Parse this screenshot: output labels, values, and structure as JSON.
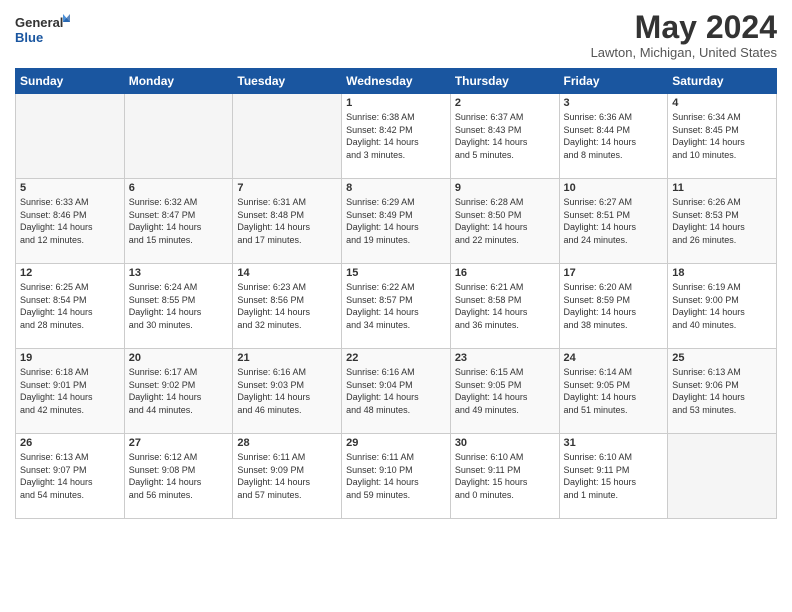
{
  "logo": {
    "line1": "General",
    "line2": "Blue"
  },
  "title": "May 2024",
  "location": "Lawton, Michigan, United States",
  "headers": [
    "Sunday",
    "Monday",
    "Tuesday",
    "Wednesday",
    "Thursday",
    "Friday",
    "Saturday"
  ],
  "weeks": [
    [
      {
        "day": "",
        "info": ""
      },
      {
        "day": "",
        "info": ""
      },
      {
        "day": "",
        "info": ""
      },
      {
        "day": "1",
        "info": "Sunrise: 6:38 AM\nSunset: 8:42 PM\nDaylight: 14 hours\nand 3 minutes."
      },
      {
        "day": "2",
        "info": "Sunrise: 6:37 AM\nSunset: 8:43 PM\nDaylight: 14 hours\nand 5 minutes."
      },
      {
        "day": "3",
        "info": "Sunrise: 6:36 AM\nSunset: 8:44 PM\nDaylight: 14 hours\nand 8 minutes."
      },
      {
        "day": "4",
        "info": "Sunrise: 6:34 AM\nSunset: 8:45 PM\nDaylight: 14 hours\nand 10 minutes."
      }
    ],
    [
      {
        "day": "5",
        "info": "Sunrise: 6:33 AM\nSunset: 8:46 PM\nDaylight: 14 hours\nand 12 minutes."
      },
      {
        "day": "6",
        "info": "Sunrise: 6:32 AM\nSunset: 8:47 PM\nDaylight: 14 hours\nand 15 minutes."
      },
      {
        "day": "7",
        "info": "Sunrise: 6:31 AM\nSunset: 8:48 PM\nDaylight: 14 hours\nand 17 minutes."
      },
      {
        "day": "8",
        "info": "Sunrise: 6:29 AM\nSunset: 8:49 PM\nDaylight: 14 hours\nand 19 minutes."
      },
      {
        "day": "9",
        "info": "Sunrise: 6:28 AM\nSunset: 8:50 PM\nDaylight: 14 hours\nand 22 minutes."
      },
      {
        "day": "10",
        "info": "Sunrise: 6:27 AM\nSunset: 8:51 PM\nDaylight: 14 hours\nand 24 minutes."
      },
      {
        "day": "11",
        "info": "Sunrise: 6:26 AM\nSunset: 8:53 PM\nDaylight: 14 hours\nand 26 minutes."
      }
    ],
    [
      {
        "day": "12",
        "info": "Sunrise: 6:25 AM\nSunset: 8:54 PM\nDaylight: 14 hours\nand 28 minutes."
      },
      {
        "day": "13",
        "info": "Sunrise: 6:24 AM\nSunset: 8:55 PM\nDaylight: 14 hours\nand 30 minutes."
      },
      {
        "day": "14",
        "info": "Sunrise: 6:23 AM\nSunset: 8:56 PM\nDaylight: 14 hours\nand 32 minutes."
      },
      {
        "day": "15",
        "info": "Sunrise: 6:22 AM\nSunset: 8:57 PM\nDaylight: 14 hours\nand 34 minutes."
      },
      {
        "day": "16",
        "info": "Sunrise: 6:21 AM\nSunset: 8:58 PM\nDaylight: 14 hours\nand 36 minutes."
      },
      {
        "day": "17",
        "info": "Sunrise: 6:20 AM\nSunset: 8:59 PM\nDaylight: 14 hours\nand 38 minutes."
      },
      {
        "day": "18",
        "info": "Sunrise: 6:19 AM\nSunset: 9:00 PM\nDaylight: 14 hours\nand 40 minutes."
      }
    ],
    [
      {
        "day": "19",
        "info": "Sunrise: 6:18 AM\nSunset: 9:01 PM\nDaylight: 14 hours\nand 42 minutes."
      },
      {
        "day": "20",
        "info": "Sunrise: 6:17 AM\nSunset: 9:02 PM\nDaylight: 14 hours\nand 44 minutes."
      },
      {
        "day": "21",
        "info": "Sunrise: 6:16 AM\nSunset: 9:03 PM\nDaylight: 14 hours\nand 46 minutes."
      },
      {
        "day": "22",
        "info": "Sunrise: 6:16 AM\nSunset: 9:04 PM\nDaylight: 14 hours\nand 48 minutes."
      },
      {
        "day": "23",
        "info": "Sunrise: 6:15 AM\nSunset: 9:05 PM\nDaylight: 14 hours\nand 49 minutes."
      },
      {
        "day": "24",
        "info": "Sunrise: 6:14 AM\nSunset: 9:05 PM\nDaylight: 14 hours\nand 51 minutes."
      },
      {
        "day": "25",
        "info": "Sunrise: 6:13 AM\nSunset: 9:06 PM\nDaylight: 14 hours\nand 53 minutes."
      }
    ],
    [
      {
        "day": "26",
        "info": "Sunrise: 6:13 AM\nSunset: 9:07 PM\nDaylight: 14 hours\nand 54 minutes."
      },
      {
        "day": "27",
        "info": "Sunrise: 6:12 AM\nSunset: 9:08 PM\nDaylight: 14 hours\nand 56 minutes."
      },
      {
        "day": "28",
        "info": "Sunrise: 6:11 AM\nSunset: 9:09 PM\nDaylight: 14 hours\nand 57 minutes."
      },
      {
        "day": "29",
        "info": "Sunrise: 6:11 AM\nSunset: 9:10 PM\nDaylight: 14 hours\nand 59 minutes."
      },
      {
        "day": "30",
        "info": "Sunrise: 6:10 AM\nSunset: 9:11 PM\nDaylight: 15 hours\nand 0 minutes."
      },
      {
        "day": "31",
        "info": "Sunrise: 6:10 AM\nSunset: 9:11 PM\nDaylight: 15 hours\nand 1 minute."
      },
      {
        "day": "",
        "info": ""
      }
    ]
  ]
}
